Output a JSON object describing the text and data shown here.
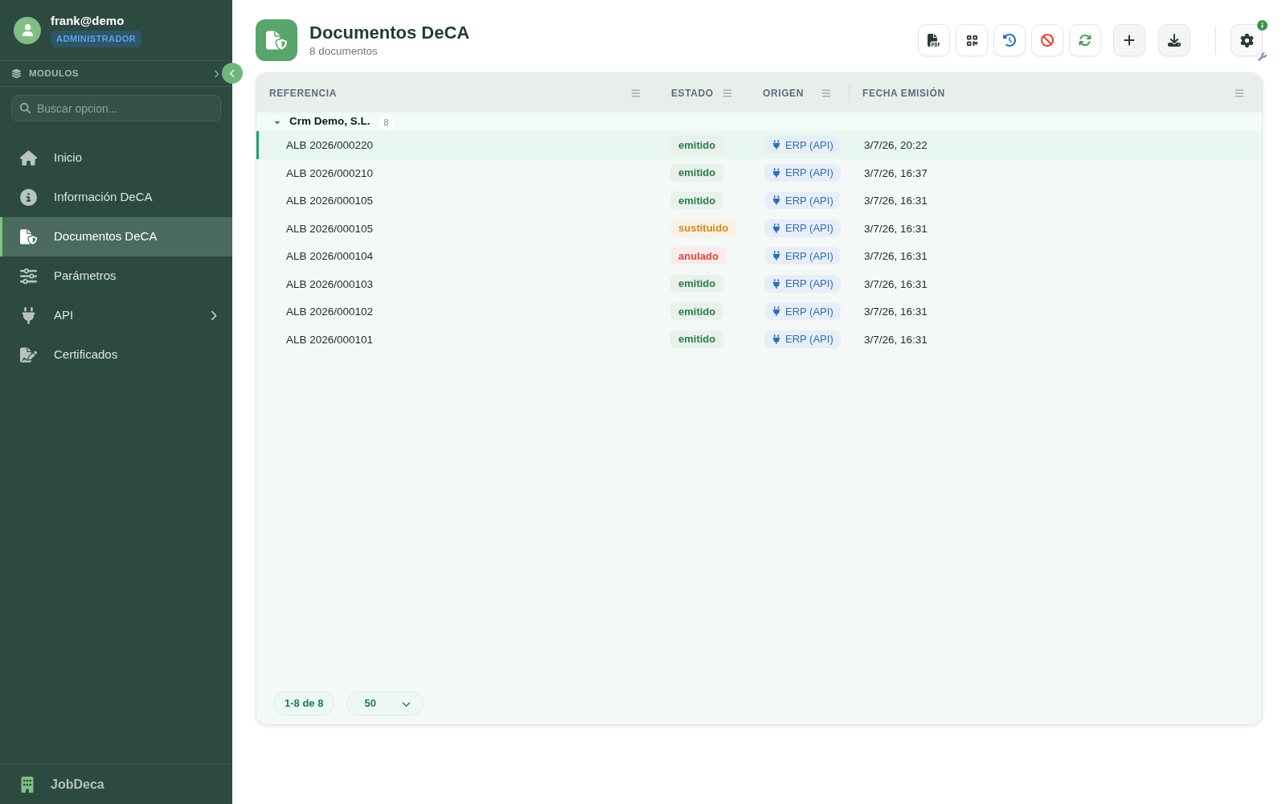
{
  "sidebar": {
    "user": {
      "name": "frank@demo",
      "role": "ADMINISTRADOR"
    },
    "section_label": "MODULOS",
    "search": {
      "placeholder": "Buscar opcion..."
    },
    "items": [
      {
        "label": "Inicio",
        "selected": false,
        "submenu": false
      },
      {
        "label": "Información DeCA",
        "selected": false,
        "submenu": false
      },
      {
        "label": "Documentos DeCA",
        "selected": true,
        "submenu": false
      },
      {
        "label": "Parámetros",
        "selected": false,
        "submenu": false
      },
      {
        "label": "API",
        "selected": false,
        "submenu": true
      },
      {
        "label": "Certificados",
        "selected": false,
        "submenu": false
      }
    ],
    "footer": {
      "label": "JobDeca"
    }
  },
  "header": {
    "title": "Documentos DeCA",
    "subtitle": "8 documentos"
  },
  "table": {
    "columns": [
      {
        "label": "REFERENCIA"
      },
      {
        "label": "ESTADO"
      },
      {
        "label": "ORIGEN"
      },
      {
        "label": "FECHA EMISIÓN"
      }
    ],
    "groups": [
      {
        "label": "Crm Demo, S.L.",
        "count": "8",
        "expanded": true,
        "rows": [
          {
            "reference": "ALB 2026/000220",
            "status": {
              "label": "emitido",
              "color": "#2f7d4e"
            },
            "origin": "ERP (API)",
            "issued": "3/7/26, 20:22",
            "selected": true
          },
          {
            "reference": "ALB 2026/000210",
            "status": {
              "label": "emitido",
              "color": "#2f7d4e"
            },
            "origin": "ERP (API)",
            "issued": "3/7/26, 16:37",
            "selected": false
          },
          {
            "reference": "ALB 2026/000105",
            "status": {
              "label": "emitido",
              "color": "#2f7d4e"
            },
            "origin": "ERP (API)",
            "issued": "3/7/26, 16:31",
            "selected": false
          },
          {
            "reference": "ALB 2026/000105",
            "status": {
              "label": "sustituido",
              "color": "#d4891a"
            },
            "origin": "ERP (API)",
            "issued": "3/7/26, 16:31",
            "selected": false
          },
          {
            "reference": "ALB 2026/000104",
            "status": {
              "label": "anulado",
              "color": "#d8483c"
            },
            "origin": "ERP (API)",
            "issued": "3/7/26, 16:31",
            "selected": false
          },
          {
            "reference": "ALB 2026/000103",
            "status": {
              "label": "emitido",
              "color": "#2f7d4e"
            },
            "origin": "ERP (API)",
            "issued": "3/7/26, 16:31",
            "selected": false
          },
          {
            "reference": "ALB 2026/000102",
            "status": {
              "label": "emitido",
              "color": "#2f7d4e"
            },
            "origin": "ERP (API)",
            "issued": "3/7/26, 16:31",
            "selected": false
          },
          {
            "reference": "ALB 2026/000101",
            "status": {
              "label": "emitido",
              "color": "#2f7d4e"
            },
            "origin": "ERP (API)",
            "issued": "3/7/26, 16:31",
            "selected": false
          }
        ]
      }
    ]
  },
  "pagination": {
    "range": "1-8 de 8",
    "page_size": "50"
  }
}
